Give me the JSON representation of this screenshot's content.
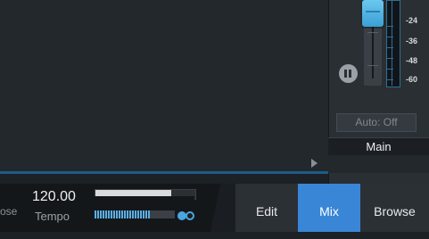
{
  "mixer": {
    "meter_scale": [
      "-24",
      "-36",
      "-48",
      "-60"
    ],
    "automation_label": "Auto: Off",
    "channel_name": "Main",
    "fader_level_percent": 100
  },
  "transport": {
    "partial_label": "ose",
    "tempo_value": "120.00",
    "tempo_label": "Tempo"
  },
  "tabs": [
    {
      "label": "Edit",
      "active": false
    },
    {
      "label": "Mix",
      "active": true
    },
    {
      "label": "Browse",
      "active": false
    }
  ],
  "colors": {
    "accent": "#3a86d6",
    "fader": "#5ab8e8",
    "panel": "#23282d"
  }
}
